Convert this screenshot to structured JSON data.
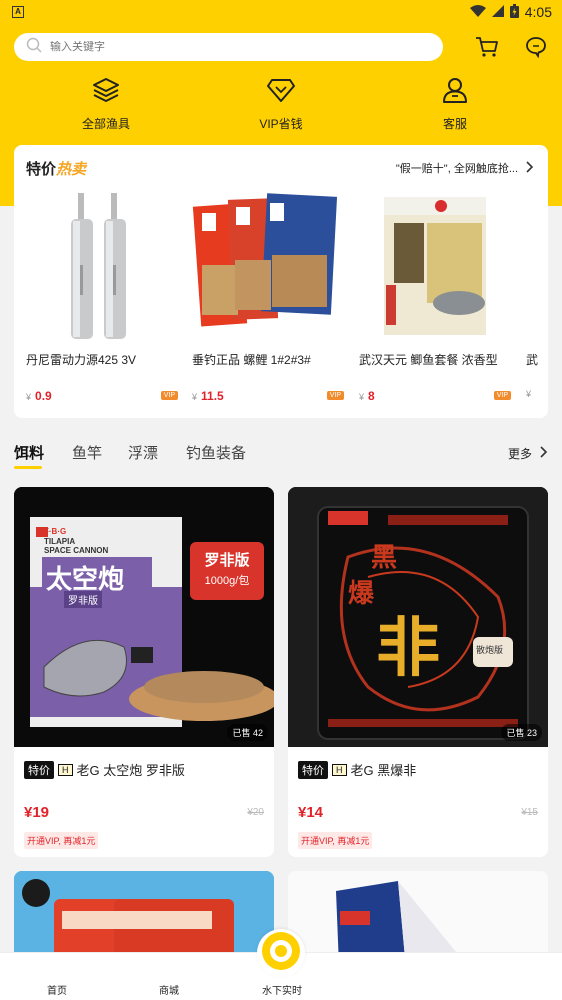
{
  "status_bar": {
    "time": "4:05",
    "app_badge": "A"
  },
  "search": {
    "placeholder": "输入关键字"
  },
  "header_icons": [
    "cart-icon",
    "chat-icon"
  ],
  "quick_nav": [
    {
      "label": "全部渔具",
      "icon": "layers-icon"
    },
    {
      "label": "VIP省钱",
      "icon": "diamond-icon"
    },
    {
      "label": "客服",
      "icon": "person-icon"
    }
  ],
  "promo": {
    "title_main": "特价",
    "title_hot": "热卖",
    "notice": "\"假一赔十\", 全网触底抢...",
    "items": [
      {
        "name": "丹尼雷动力源425 3V",
        "price": "0.9",
        "yen": "¥",
        "vip": "VIP"
      },
      {
        "name": "垂钓正品 螺鲤 1#2#3#",
        "price": "11.5",
        "yen": "¥",
        "vip": "VIP"
      },
      {
        "name": "武汉天元 鲫鱼套餐 浓香型",
        "price": "8",
        "yen": "¥",
        "vip": "VIP"
      },
      {
        "name": "武",
        "price": "",
        "yen": "¥",
        "vip": ""
      }
    ]
  },
  "categories": {
    "tabs": [
      "饵料",
      "鱼竿",
      "浮漂",
      "钓鱼装备"
    ],
    "more": "更多"
  },
  "products": [
    {
      "sold": "已售 42",
      "tag": "特价",
      "h": "H",
      "name": "老G 太空炮 罗非版",
      "price": "¥19",
      "orig": "¥20",
      "vip_note": "开通VIP, 再减1元",
      "pkg_en1": "TILAPIA",
      "pkg_en2": "SPACE CANNON",
      "pkg_cn": "太空炮",
      "pkg_sub": "罗非版",
      "badge_line1": "罗非版",
      "badge_line2": "1000g/包"
    },
    {
      "sold": "已售 23",
      "tag": "特价",
      "h": "H",
      "name": "老G 黑爆非",
      "price": "¥14",
      "orig": "¥15",
      "vip_note": "开通VIP, 再减1元",
      "pkg_cn1": "黑",
      "pkg_cn2": "爆",
      "pkg_cn3": "非",
      "pkg_sub": "散炮版"
    }
  ],
  "bottom_nav": [
    "首页",
    "商城",
    "水下实时"
  ],
  "colors": {
    "brand_yellow": "#ffd000",
    "price_red": "#e0232a",
    "vip_orange": "#f28b2c"
  }
}
